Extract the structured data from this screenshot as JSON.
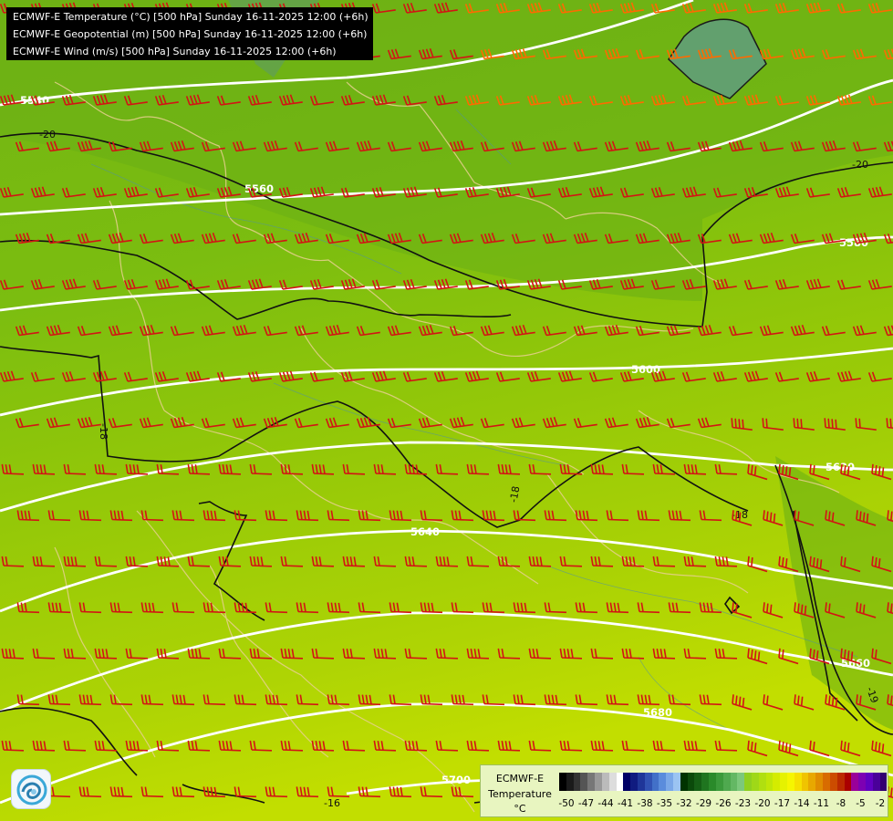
{
  "info": {
    "line1": "ECMWF-E Temperature (°C) [500 hPa] Sunday 16-11-2025 12:00 (+6h)",
    "line2": "ECMWF-E Geopotential (m) [500 hPa] Sunday 16-11-2025 12:00 (+6h)",
    "line3": "ECMWF-E Wind (m/s) [500 hPa] Sunday 16-11-2025 12:00 (+6h)"
  },
  "legend": {
    "title1": "ECMWF-E",
    "title2": "Temperature",
    "unit": "°C",
    "ticks": [
      "-50",
      "-47",
      "-44",
      "-41",
      "-38",
      "-35",
      "-32",
      "-29",
      "-26",
      "-23",
      "-20",
      "-17",
      "-14",
      "-11",
      "-8",
      "-5",
      "-2"
    ],
    "colors": [
      "#000000",
      "#1a1a1a",
      "#333333",
      "#555555",
      "#777777",
      "#999999",
      "#bbbbbb",
      "#dddddd",
      "#ffffff",
      "#000066",
      "#101b80",
      "#1f3699",
      "#3152b3",
      "#4270c8",
      "#5a8cdc",
      "#7aa8e8",
      "#9bc4f2",
      "#003300",
      "#0b4a0b",
      "#155f15",
      "#1f751f",
      "#2a8a2a",
      "#3b9a3b",
      "#4fa94f",
      "#64b864",
      "#7cc87c",
      "#8fd020",
      "#9fd818",
      "#b0df10",
      "#c0e608",
      "#d4ec00",
      "#e6f200",
      "#f6f600",
      "#f6e000",
      "#f0c400",
      "#e8a800",
      "#e08c00",
      "#d86c00",
      "#cc4c00",
      "#bb2a00",
      "#aa0000",
      "#9a0099",
      "#7d00b3",
      "#6100c0",
      "#4a0099",
      "#330070"
    ]
  },
  "contours": {
    "height_labels": [
      "5540",
      "5560",
      "5580",
      "5600",
      "5620",
      "5640",
      "5660",
      "5680",
      "5700"
    ],
    "temp_labels": [
      "-20",
      "-20",
      "-18",
      "-18",
      "-18",
      "-16",
      "-19"
    ]
  },
  "logo": {
    "name": "ECMWF logo"
  }
}
